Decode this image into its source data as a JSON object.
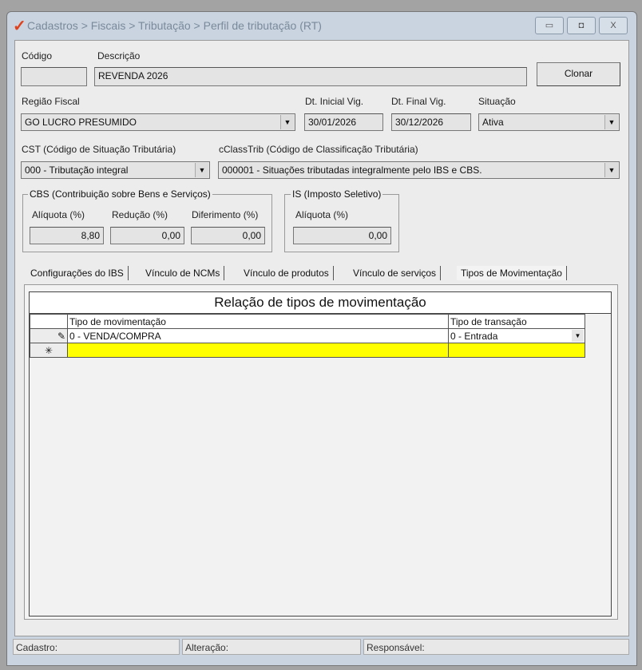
{
  "window": {
    "title": "Cadastros > Fiscais > Tributação > Perfil de tributação (RT)",
    "minimize": "▭",
    "maximize": "◘",
    "close": "X"
  },
  "form": {
    "codigo_label": "Código",
    "codigo_value": "",
    "descricao_label": "Descrição",
    "descricao_value": "REVENDA 2026",
    "clonar": "Clonar",
    "regiao_label": "Região Fiscal",
    "regiao_value": "GO LUCRO PRESUMIDO",
    "dt_inicial_label": "Dt. Inicial Vig.",
    "dt_inicial_value": "30/01/2026",
    "dt_final_label": "Dt. Final Vig.",
    "dt_final_value": "30/12/2026",
    "situacao_label": "Situação",
    "situacao_value": "Ativa",
    "cst_label": "CST (Código de Situação Tributária)",
    "cst_value": "000 - Tributação integral",
    "cclass_label": "cClassTrib (Código de Classificação Tributária)",
    "cclass_value": "000001 - Situações tributadas integralmente pelo IBS e CBS.",
    "cbs": {
      "title": "CBS (Contribuição sobre Bens e Serviços)",
      "aliquota_label": "Alíquota (%)",
      "aliquota": "8,80",
      "reducao_label": "Redução (%)",
      "reducao": "0,00",
      "diferimento_label": "Diferimento (%)",
      "diferimento": "0,00"
    },
    "is": {
      "title": "IS (Imposto Seletivo)",
      "aliquota_label": "Alíquota (%)",
      "aliquota": "0,00"
    }
  },
  "tabs": [
    "Configurações do IBS",
    "Vínculo de NCMs",
    "Vínculo de produtos",
    "Vínculo de serviços",
    "Tipos de Movimentação"
  ],
  "grid": {
    "title": "Relação de tipos de movimentação",
    "columns": [
      "Tipo de movimentação",
      "Tipo de transação"
    ],
    "rows": [
      {
        "indicator": "✎",
        "tipo": "0 - VENDA/COMPRA",
        "transacao": "0 - Entrada"
      }
    ],
    "new_row_indicator": "✳"
  },
  "status": {
    "cadastro": "Cadastro:",
    "alteracao": "Alteração:",
    "responsavel": "Responsável:"
  }
}
